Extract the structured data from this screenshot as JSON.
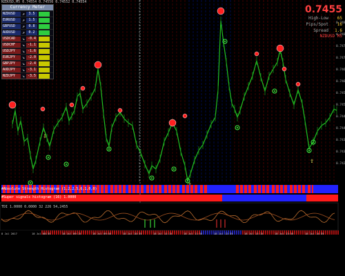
{
  "window": {
    "title": "NZDUSD,M5  0.74554 0.74556 0.74552 0.74554"
  },
  "strength_panel": {
    "header": "Currency Meter",
    "rows": [
      {
        "pair": "NZDUSD",
        "arrow": "↗",
        "value": "3.5",
        "color": "#2ecc40"
      },
      {
        "pair": "EURUSD",
        "arrow": "↗",
        "value": "1.5",
        "color": "#2ecc40"
      },
      {
        "pair": "GBPUSD",
        "arrow": "↗",
        "value": "0.8",
        "color": "#2ecc40"
      },
      {
        "pair": "AUDUSD",
        "arrow": "↗",
        "value": "0.2",
        "color": "#2ecc40"
      },
      {
        "pair": "USDCAD",
        "arrow": "↘",
        "value": "-0.4",
        "color": "#c8c800"
      },
      {
        "pair": "USDCHF",
        "arrow": "↘",
        "value": "-1.1",
        "color": "#c8c800"
      },
      {
        "pair": "USDJPY",
        "arrow": "↘",
        "value": "-1.6",
        "color": "#c8c800"
      },
      {
        "pair": "EURJPY",
        "arrow": "↘",
        "value": "-2.0",
        "color": "#c8c800"
      },
      {
        "pair": "GBPJPY",
        "arrow": "↘",
        "value": "-2.4",
        "color": "#c8c800"
      },
      {
        "pair": "AUDJPY",
        "arrow": "↘",
        "value": "-3.1",
        "color": "#c8c800"
      },
      {
        "pair": "NZDJPY",
        "arrow": "↘",
        "value": "-3.5",
        "color": "#c8c800"
      }
    ]
  },
  "info_box": {
    "price": "0.7455",
    "rows": [
      {
        "label": "High-Low",
        "value": "65"
      },
      {
        "label": "Pips/Spot",
        "value": "16"
      },
      {
        "label": "Spread",
        "value": "1.6"
      }
    ],
    "footer": "NZDUSD M5"
  },
  "price_axis": [
    "0.7485",
    "0.7480",
    "0.7475",
    "0.7470",
    "0.7465",
    "0.7460",
    "0.7455",
    "0.7450",
    "0.7445",
    "0.7440",
    "0.7435",
    "0.7430",
    "0.7425"
  ],
  "time_axis": [
    "8 Jul 2017",
    "18 Jul 08:35",
    "18 Jul 09:15",
    "18 Jul 09:55",
    "18 Jul 10:35",
    "18 Jul 11:15",
    "18 Jul 11:55",
    "18 Jul 12:35",
    "18 Jul 13:15",
    "18 Jul 13:55",
    "18 Jul 14:35"
  ],
  "indicators": {
    "strength_label": "#Absolute Strength Histogram (1,2,2,5,6,1,0,0)",
    "super_signal_label": "#Super signals histogram (16) 1.0000",
    "tdi_label": "TDI 1.0000 0.0000 32 226 54,2455"
  },
  "colors": {
    "background": "#000000",
    "price_line": "#22c422",
    "signal_top": "#ff2020",
    "signal_bottom": "#44ff44"
  }
}
